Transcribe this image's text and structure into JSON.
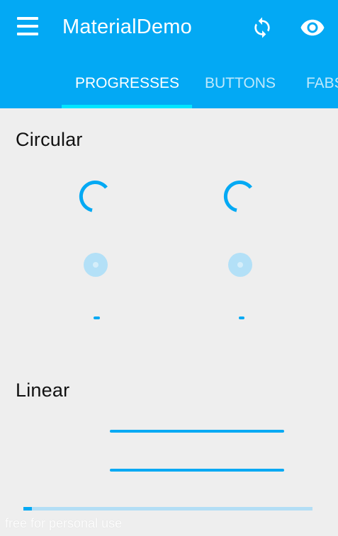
{
  "app": {
    "title": "MaterialDemo",
    "accent_color": "#03a9f4",
    "indicator_color": "#00e5ff",
    "icons": [
      "menu-icon",
      "sync-icon",
      "visibility-icon"
    ]
  },
  "tabs": [
    {
      "label": "PROGRESSES",
      "active": true
    },
    {
      "label": "BUTTONS",
      "active": false
    },
    {
      "label": "FABS",
      "active": false
    }
  ],
  "sections": {
    "circular": {
      "title": "Circular"
    },
    "linear": {
      "title": "Linear"
    }
  },
  "linear_progress": {
    "determinate_fraction": 0.03
  },
  "watermark": "free for personal use"
}
